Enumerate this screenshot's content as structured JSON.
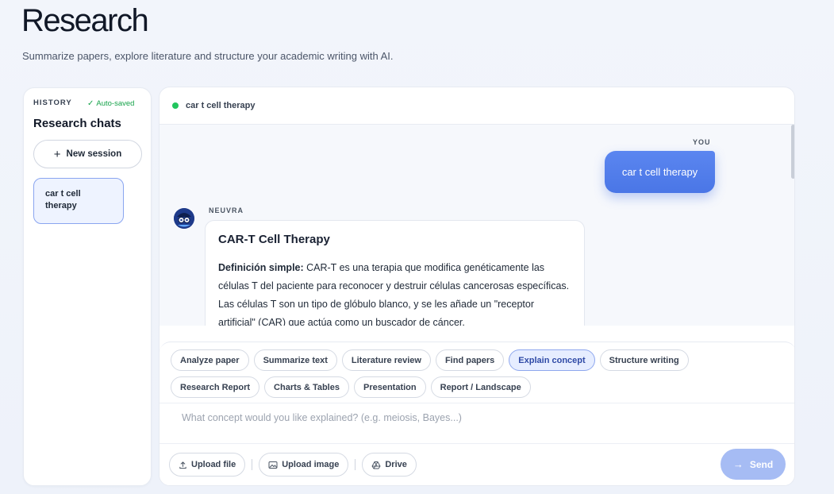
{
  "page": {
    "title": "Research",
    "subtitle": "Summarize papers, explore literature and structure your academic writing with AI."
  },
  "sidebar": {
    "history_label": "HISTORY",
    "autosaved": "Auto-saved",
    "title": "Research chats",
    "new_session": "New session",
    "sessions": [
      {
        "label": "car t cell therapy"
      }
    ]
  },
  "chat": {
    "header_title": "car t cell therapy",
    "status_color": "#22c55e",
    "user_label": "YOU",
    "user_message": "car t cell therapy",
    "bot_label": "NEUVRA",
    "bot_card": {
      "title": "CAR-T Cell Therapy",
      "definition_label": "Definición simple:",
      "definition_text": " CAR-T es una terapia que modifica genéticamente las células T del paciente para reconocer y destruir células cancerosas específicas. Las células T son un tipo de glóbulo blanco, y se les añade un \"receptor artificial\" (CAR) que actúa como un buscador de cáncer."
    }
  },
  "composer": {
    "modes_row1": [
      "Analyze paper",
      "Summarize text",
      "Literature review",
      "Find papers",
      "Explain concept",
      "Structure writing"
    ],
    "modes_row2": [
      "Research Report",
      "Charts & Tables",
      "Presentation",
      "Report / Landscape"
    ],
    "active_mode": "Explain concept",
    "input_value": "",
    "input_placeholder": "What concept would you like explained? (e.g. meiosis, Bayes...)",
    "upload_file": "Upload file",
    "upload_image": "Upload image",
    "drive": "Drive",
    "send": "Send"
  },
  "colors": {
    "accent": "#4a76e6",
    "send_disabled": "#a6bcf4",
    "active_chip_bg": "#e6edff"
  }
}
